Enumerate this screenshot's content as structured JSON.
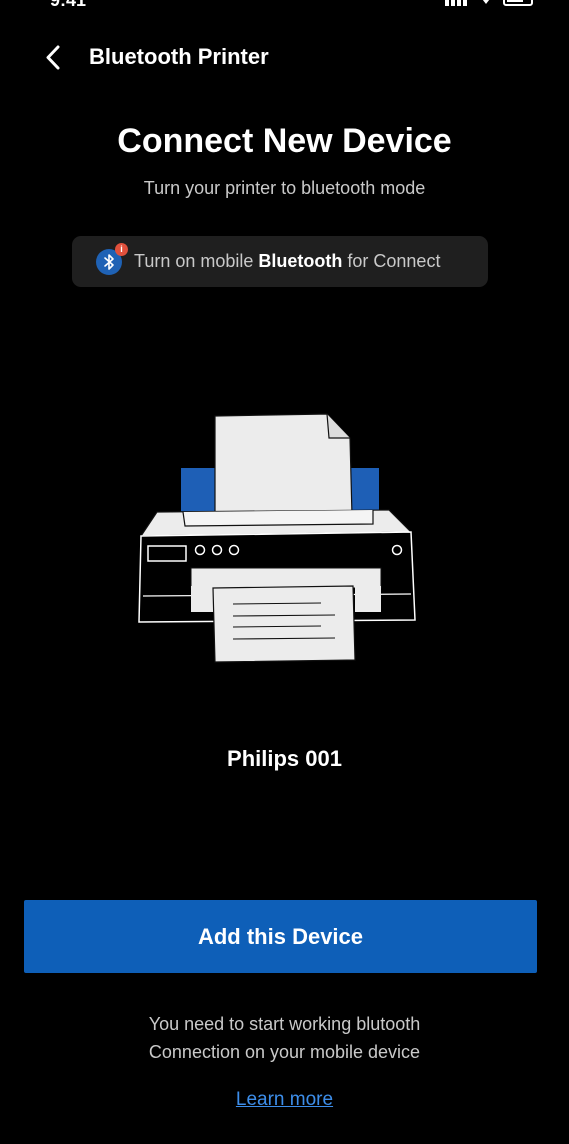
{
  "status_bar": {
    "time": "9:41",
    "icons": [
      "signal-icon",
      "wifi-icon",
      "battery-icon"
    ]
  },
  "header": {
    "back_icon": "chevron-left-icon",
    "title": "Bluetooth Printer"
  },
  "main": {
    "title": "Connect New Device",
    "subtitle": "Turn your printer to bluetooth mode",
    "bluetooth_banner": {
      "icon": "bluetooth-icon",
      "badge": "i",
      "text_before": "Turn on mobile ",
      "text_bold": "Bluetooth",
      "text_after": " for Connect"
    },
    "illustration": "printer-illustration",
    "device_name": "Philips 001"
  },
  "actions": {
    "add_device_label": "Add this Device",
    "note_line1": "You need to start working blutooth",
    "note_line2": "Connection on your mobile device",
    "learn_more_label": "Learn more"
  },
  "colors": {
    "background": "#000000",
    "accent": "#0e5fb8",
    "banner_bg": "#1f1f1f",
    "link": "#3d8eea",
    "badge": "#e0503c",
    "printer_blue": "#1e5fb6"
  }
}
